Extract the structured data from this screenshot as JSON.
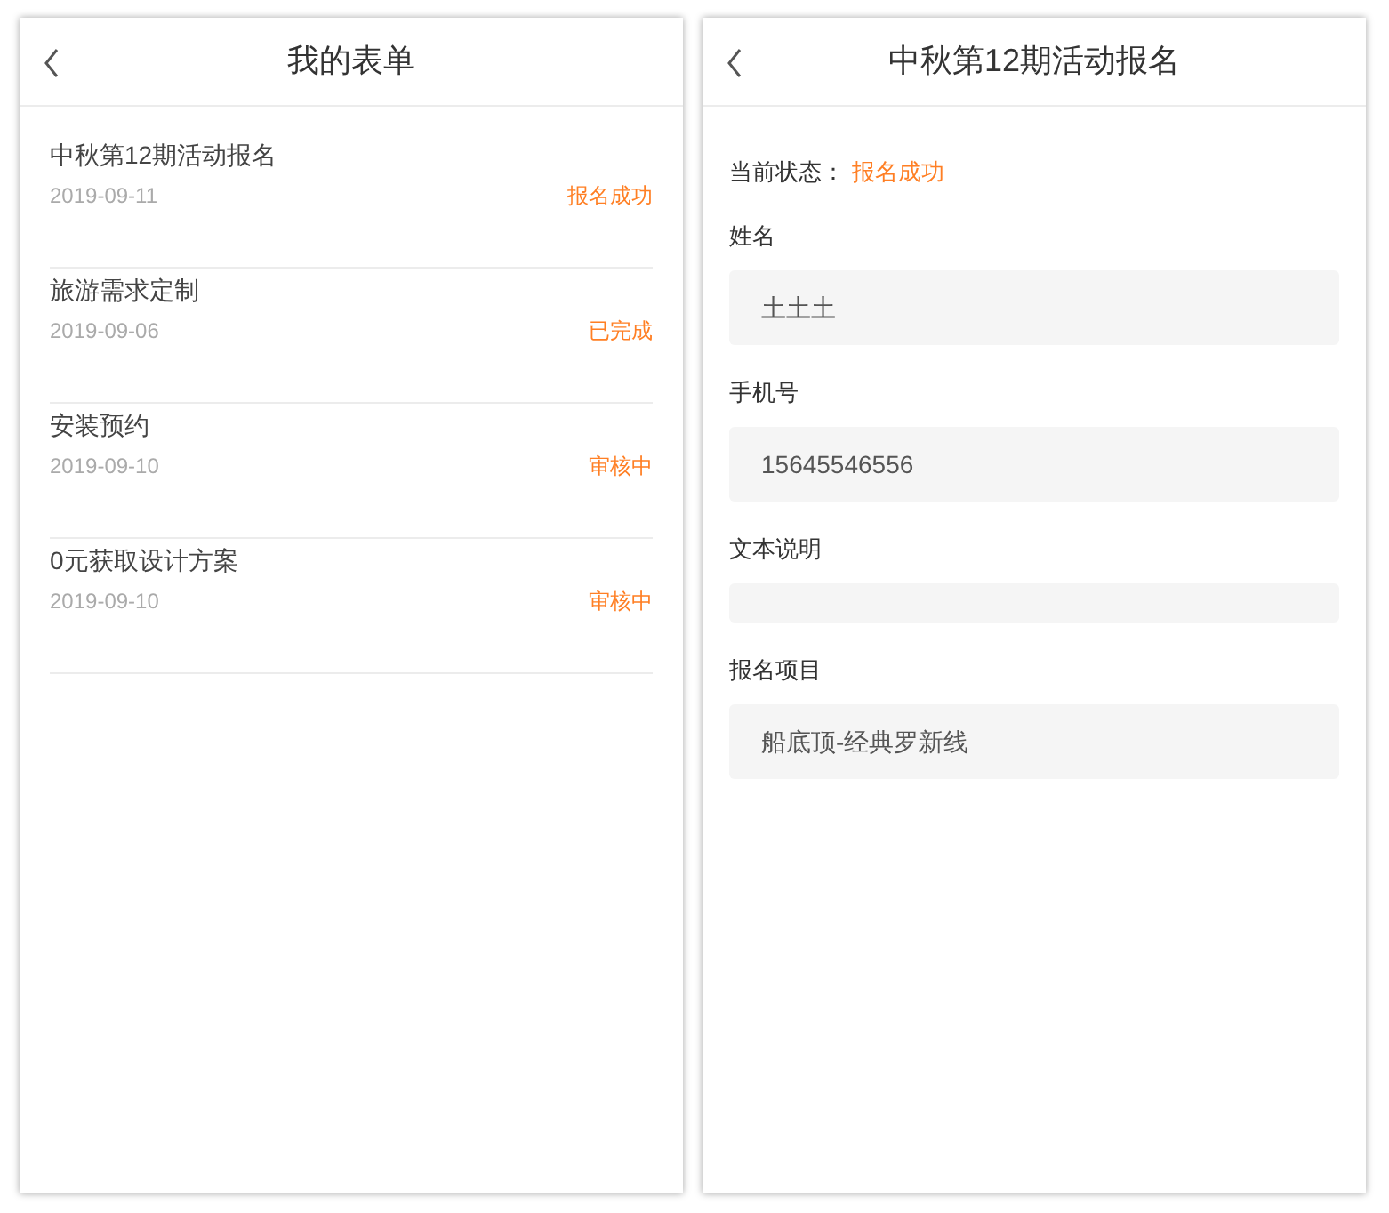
{
  "list_screen": {
    "title": "我的表单",
    "items": [
      {
        "title": "中秋第12期活动报名",
        "date": "2019-09-11",
        "status": "报名成功"
      },
      {
        "title": "旅游需求定制",
        "date": "2019-09-06",
        "status": "已完成"
      },
      {
        "title": "安装预约",
        "date": "2019-09-10",
        "status": "审核中"
      },
      {
        "title": "0元获取设计方案",
        "date": "2019-09-10",
        "status": "审核中"
      }
    ]
  },
  "detail_screen": {
    "title": "中秋第12期活动报名",
    "status_label": "当前状态：",
    "status_value": "报名成功",
    "fields": [
      {
        "label": "姓名",
        "value": "土土土"
      },
      {
        "label": "手机号",
        "value": "15645546556"
      },
      {
        "label": "文本说明"
      },
      {
        "label": "报名项目",
        "value": "船底顶-经典罗新线"
      }
    ]
  }
}
